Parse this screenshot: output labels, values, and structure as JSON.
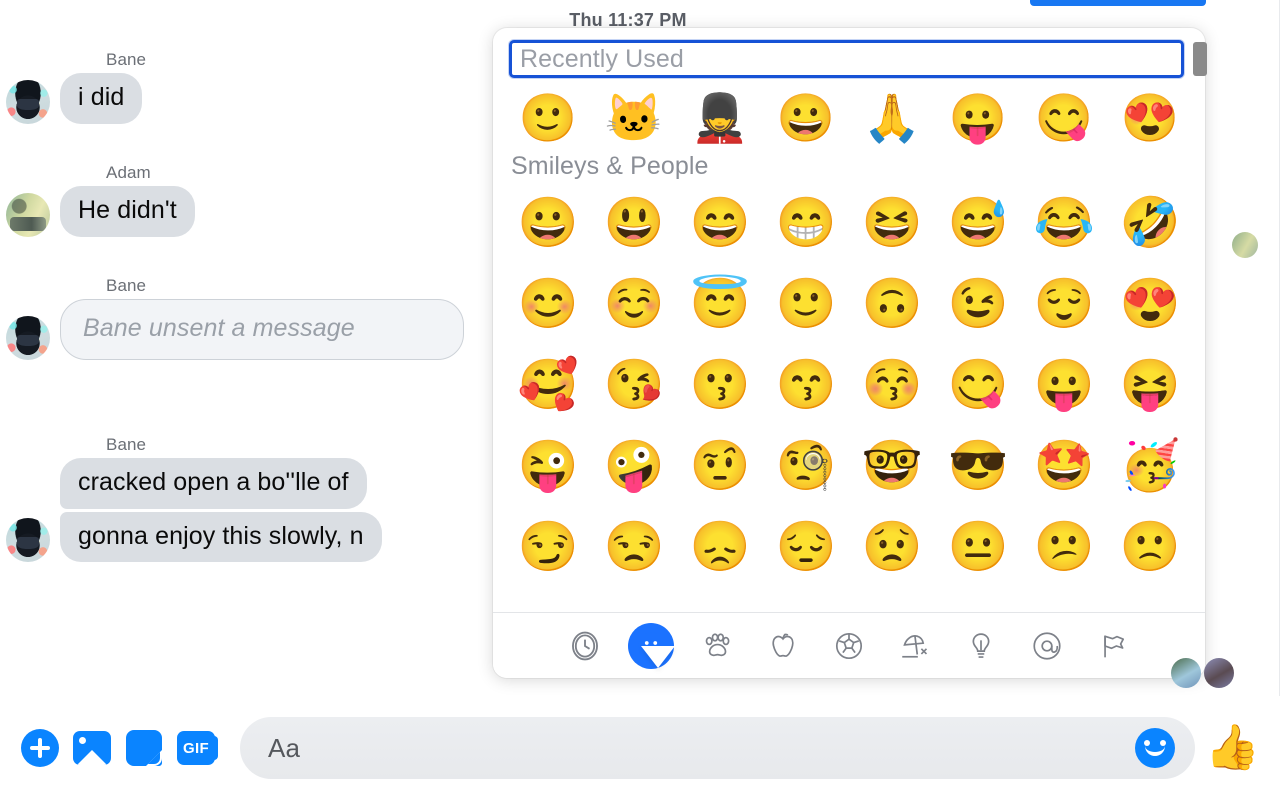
{
  "app": {
    "name": "Messenger",
    "accent_color": "#0a84ff",
    "bubble_color": "#dadee3",
    "focus_ring_color": "#1652d6"
  },
  "thread": {
    "timestamp": "Thu 11:37 PM",
    "messages": [
      {
        "sender": "Bane",
        "text": "i did",
        "style": "bubble",
        "avatar": "bane"
      },
      {
        "sender": "Adam",
        "text": "He didn't",
        "style": "bubble",
        "avatar": "adam"
      },
      {
        "sender": "Bane",
        "text": "Bane unsent a message",
        "style": "unsent",
        "avatar": "bane"
      },
      {
        "sender": "Bane",
        "text": "cracked open a bo''lle of",
        "style": "stack-top",
        "avatar": "none"
      },
      {
        "sender": "Bane",
        "text": "gonna enjoy this slowly, n",
        "style": "stack-bot",
        "avatar": "bane"
      }
    ]
  },
  "emoji_picker": {
    "search": {
      "placeholder": "Recently Used",
      "value": ""
    },
    "recent_label": "Recently Used",
    "recent": [
      "🙂",
      "🐱",
      "💂",
      "😀",
      "🙏",
      "😛",
      "😋",
      "😍"
    ],
    "sections": [
      {
        "title": "Smileys & People",
        "emojis": [
          "😀",
          "😃",
          "😄",
          "😁",
          "😆",
          "😅",
          "😂",
          "🤣",
          "😊",
          "☺️",
          "😇",
          "🙂",
          "🙃",
          "😉",
          "😌",
          "😍",
          "🥰",
          "😘",
          "😗",
          "😙",
          "😚",
          "😋",
          "😛",
          "😝",
          "😜",
          "🤪",
          "🤨",
          "🧐",
          "🤓",
          "😎",
          "🤩",
          "🥳",
          "😏",
          "😒",
          "😞",
          "😔",
          "😟",
          "😐",
          "😕",
          "🙁"
        ]
      }
    ],
    "categories": [
      {
        "name": "recent",
        "icon": "clock-icon",
        "active": false
      },
      {
        "name": "smileys",
        "icon": "smiley-icon",
        "active": true
      },
      {
        "name": "animals",
        "icon": "paw-icon",
        "active": false
      },
      {
        "name": "food",
        "icon": "apple-icon",
        "active": false
      },
      {
        "name": "activity",
        "icon": "soccer-ball-icon",
        "active": false
      },
      {
        "name": "travel",
        "icon": "beach-umbrella-icon",
        "active": false
      },
      {
        "name": "objects",
        "icon": "lightbulb-icon",
        "active": false
      },
      {
        "name": "symbols",
        "icon": "at-sign-icon",
        "active": false
      },
      {
        "name": "flags",
        "icon": "flag-icon",
        "active": false
      }
    ]
  },
  "composer": {
    "placeholder": "Aa",
    "value": "",
    "actions": [
      {
        "name": "add-attachment",
        "icon": "plus-icon"
      },
      {
        "name": "photo",
        "icon": "photo-icon"
      },
      {
        "name": "sticker",
        "icon": "sticker-icon"
      },
      {
        "name": "gif",
        "icon": "gif-icon",
        "label": "GIF"
      }
    ],
    "emoji_button": "emoji-icon",
    "like_button": "👍"
  }
}
